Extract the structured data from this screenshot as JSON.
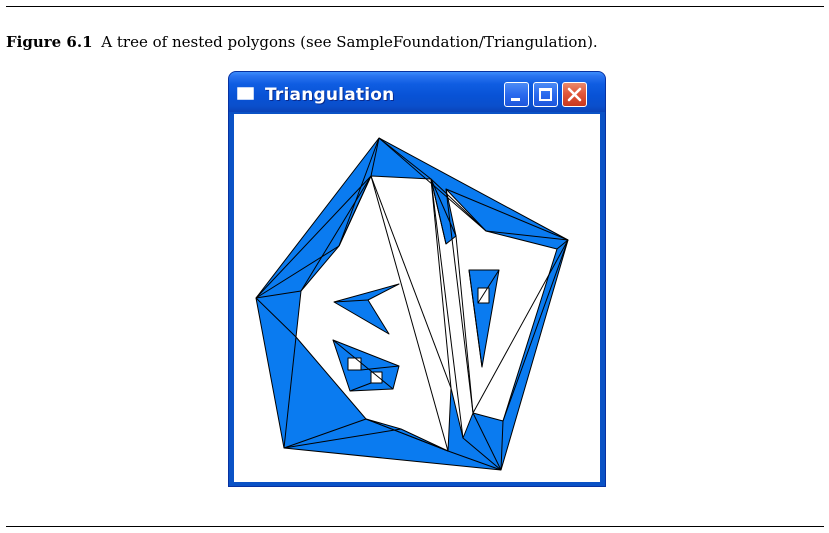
{
  "caption": {
    "label": "Figure 6.1",
    "text": "A tree of nested polygons (see SampleFoundation/Triangulation)."
  },
  "window": {
    "title": "Triangulation",
    "buttons": {
      "minimize_icon": "minimize-icon",
      "maximize_icon": "maximize-icon",
      "close_icon": "close-icon"
    }
  },
  "colors": {
    "titlebar": "#0a52c6",
    "fill": "#0a7bf0",
    "stroke": "#000000",
    "background": "#ffffff",
    "close": "#e0573a"
  }
}
